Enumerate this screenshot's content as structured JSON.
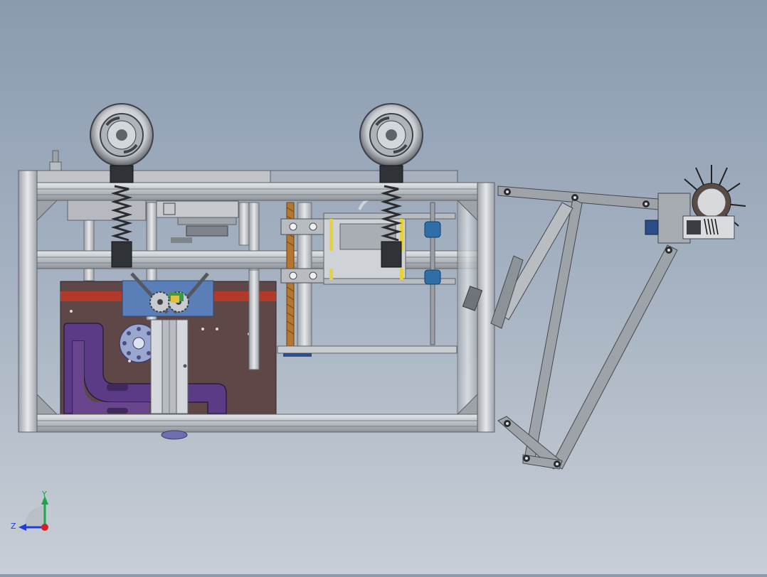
{
  "colors": {
    "background_top": "#8a9bb0",
    "background_bottom": "#c8ced6",
    "frame_aluminum": "#c3c7cc",
    "frame_dark": "#5e6166",
    "plate_brown": "#5e4746",
    "cam_purple": "#5b3b86",
    "accent_red": "#b23a2a",
    "bracket_blue": "#5a7fb8",
    "axis_y": "#1aa64a",
    "axis_z": "#1f3fd6",
    "axis_origin": "#d0202a"
  },
  "triad": {
    "y_label": "Y",
    "z_label": "Z"
  },
  "icons": {
    "orientation_triad": "axis-triad-icon"
  }
}
